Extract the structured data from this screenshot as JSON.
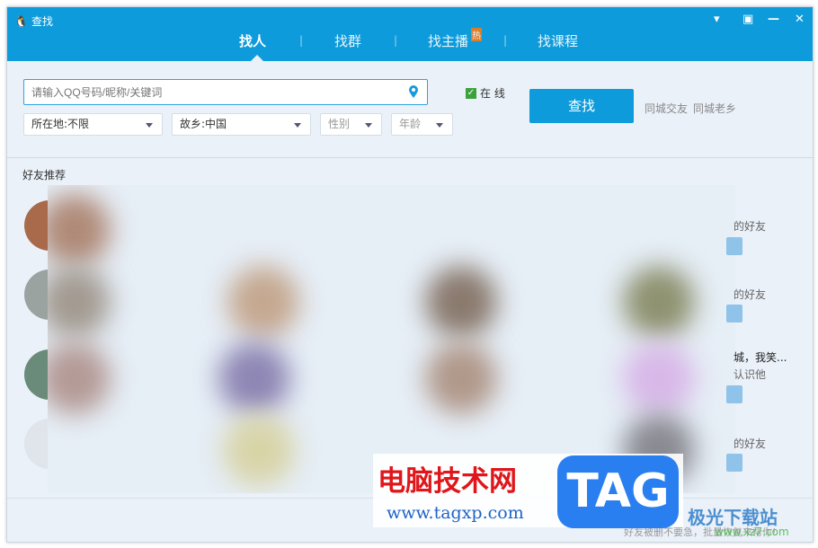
{
  "window": {
    "title": "查找",
    "controls": [
      "feedback",
      "minimize-to-tray",
      "minimize",
      "close"
    ]
  },
  "tabs": [
    {
      "label": "找人",
      "active": true
    },
    {
      "label": "找群"
    },
    {
      "label": "找主播",
      "badge": "热"
    },
    {
      "label": "找课程"
    }
  ],
  "search": {
    "placeholder": "请输入QQ号码/昵称/关键词",
    "value": "",
    "online_label": "在 线",
    "online_checked": true,
    "button": "查找"
  },
  "filters": {
    "location": "所在地:不限",
    "hometown": "故乡:中国",
    "gender": "性别",
    "age": "年龄"
  },
  "links": [
    "同城交友",
    "同城老乡"
  ],
  "section_title": "好友推荐",
  "rows": [
    {
      "text": "的好友"
    },
    {
      "text": "的好友"
    },
    {
      "text": "城，我笑...",
      "sub": "认识他"
    },
    {
      "text": "的好友"
    }
  ],
  "footer": "好友被删不要急，批量恢复来帮你!",
  "watermarks": {
    "site": "电脑技术网",
    "url": "www.tagxp.com",
    "tag": "TAG",
    "logo": "极光下载站",
    "logo_url": "www.xz7.com"
  },
  "colors": {
    "header": "#0e9bdb",
    "background": "#eaf1f9",
    "hot_badge": "#f47a16"
  }
}
